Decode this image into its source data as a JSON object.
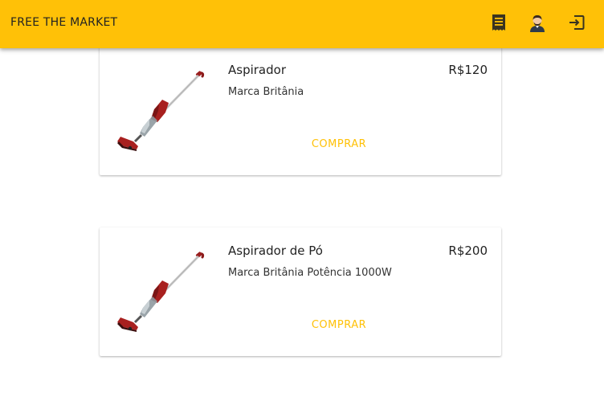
{
  "header": {
    "title": "FREE THE MARKET",
    "icons": [
      "receipt-icon",
      "avatar-icon",
      "logout-icon"
    ]
  },
  "products": [
    {
      "name": "Aspirador",
      "price": "R$120",
      "description": "Marca Britânia",
      "buy_label": "COMPRAR"
    },
    {
      "name": "Aspirador de Pó",
      "price": "R$200",
      "description": "Marca Britânia Potência 1000W",
      "buy_label": "COMPRAR"
    }
  ],
  "colors": {
    "accent": "#ffc107",
    "product_red": "#a8201f"
  }
}
